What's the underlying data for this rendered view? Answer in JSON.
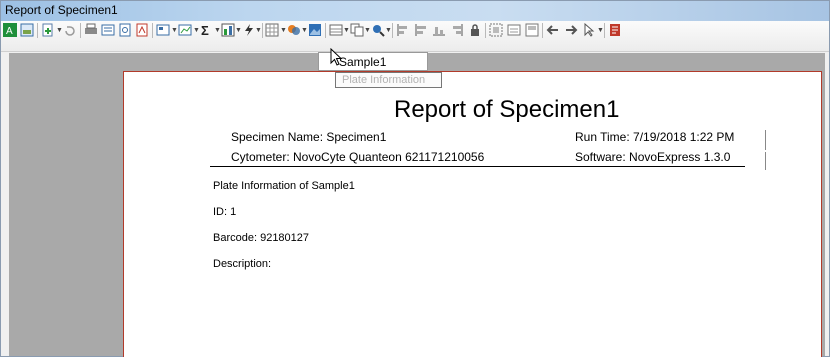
{
  "window": {
    "title": "Report of Specimen1"
  },
  "toolbar": {
    "icons": [
      "export-excel-icon",
      "image-icon",
      "add-icon",
      "undo-icon",
      "print-icon",
      "print-preview-icon",
      "page-setup-icon",
      "pdf-icon",
      "layout-icon",
      "statistics-icon",
      "sum-icon",
      "chart-icon",
      "flash-icon",
      "plate-info-icon",
      "color-icon",
      "picture-icon",
      "table-icon",
      "copy-icon",
      "zoom-icon",
      "align-left-icon",
      "align-center-icon",
      "align-right-icon",
      "lock-icon",
      "group-icon",
      "previous-icon",
      "next-icon",
      "pointer-icon",
      "document-icon"
    ]
  },
  "dropdown": {
    "selected": "Sample1",
    "tooltip": "Plate Information"
  },
  "report": {
    "title": "Report of Specimen1",
    "specimen_name": "Specimen Name: Specimen1",
    "run_time": "Run Time: 7/19/2018 1:22 PM",
    "cytometer": "Cytometer: NovoCyte Quanteon 621171210056",
    "software": "Software: NovoExpress 1.3.0",
    "plate_info": "Plate Information of Sample1",
    "id": "ID: 1",
    "barcode": "Barcode: 92180127",
    "description": "Description:"
  }
}
